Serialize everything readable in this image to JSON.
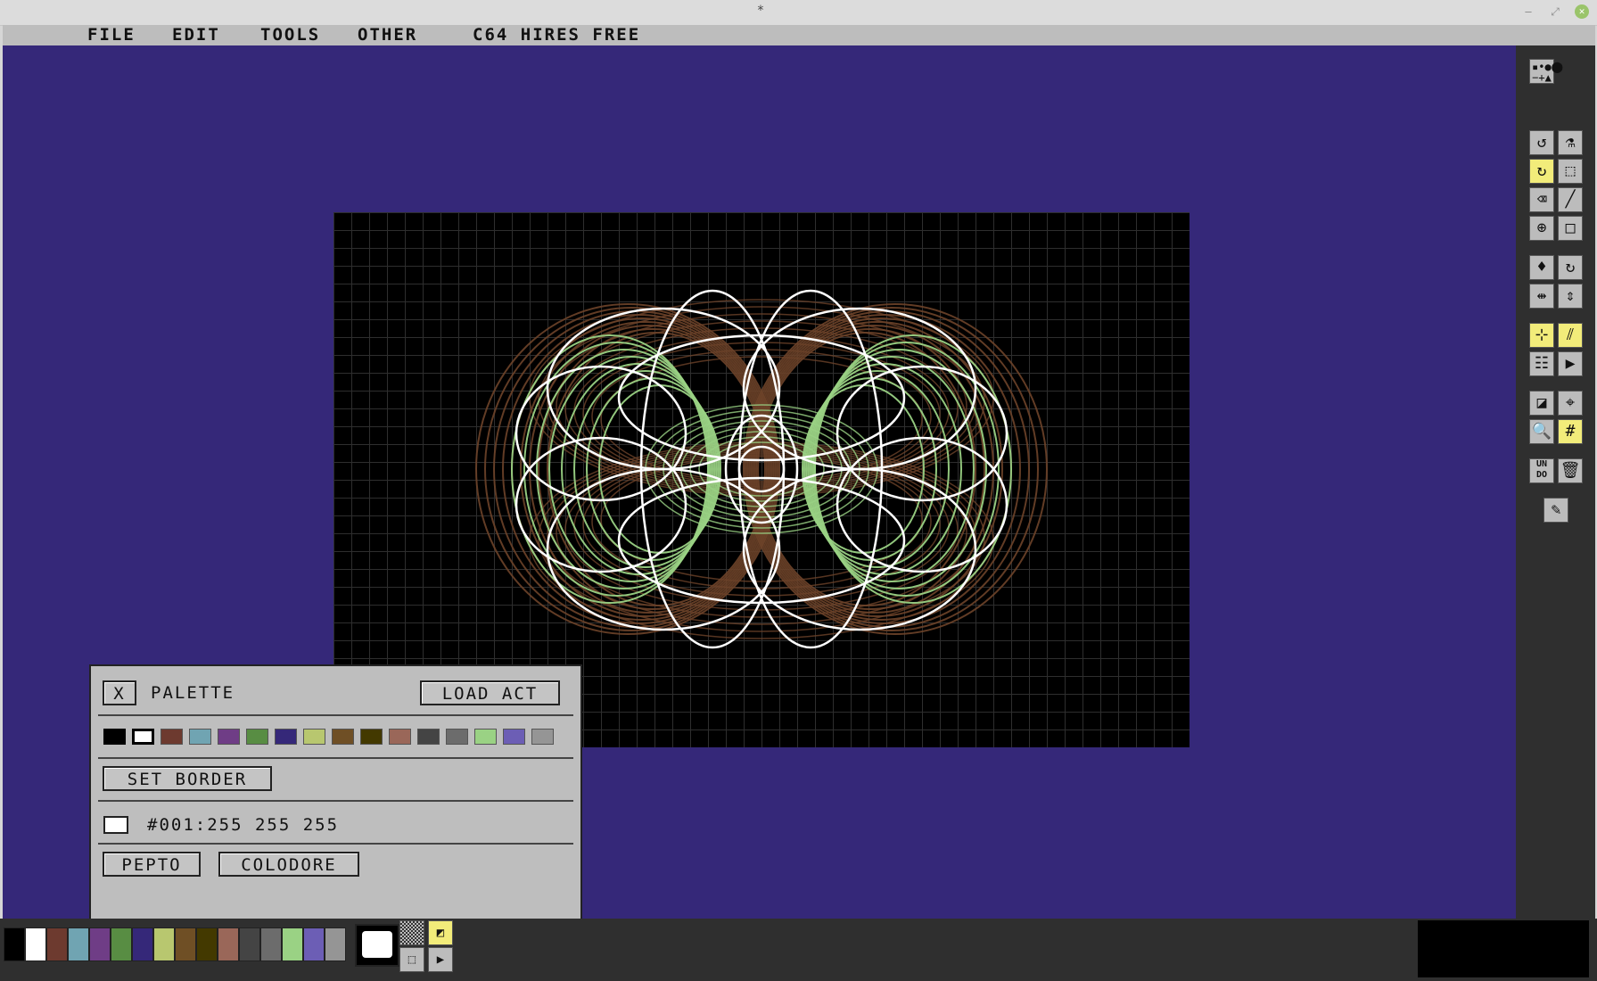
{
  "window": {
    "title": "*"
  },
  "menu": [
    "FILE",
    "EDIT",
    "TOOLS",
    "OTHER",
    "C64 HIRES FREE"
  ],
  "palette_panel": {
    "close_label": "X",
    "title": "PALETTE",
    "load_act_label": "LOAD ACT",
    "set_border_label": "SET BORDER",
    "color_readout": "#001:255 255 255",
    "pepto_label": "PEPTO",
    "colodore_label": "COLODORE"
  },
  "colors": {
    "workspace_bg": "#352879",
    "canvas_bg": "#000000",
    "white_curves": "#ffffff",
    "green_curves": "#9ad284",
    "brown_curves": "#6d4229",
    "highlight_tool": "#f2ec7a"
  },
  "c64_palette": [
    "#000000",
    "#ffffff",
    "#6d3a2f",
    "#70a4b2",
    "#6f3d86",
    "#588d43",
    "#352879",
    "#b8c76f",
    "#6f4f25",
    "#433900",
    "#9a6759",
    "#444444",
    "#6c6c6c",
    "#9ad284",
    "#6c5eb5",
    "#959595"
  ],
  "toolbar_icons": [
    "pen-dot-icon",
    "brush-dot-icon",
    "brush-small-icon",
    "brush-large-icon",
    "line-minus-icon",
    "line-plus-icon",
    "stamp-icon",
    "lasso-icon",
    "spray-icon",
    "rotate-icon",
    "selection-icon",
    "eraser-icon",
    "line-draw-icon",
    "circle-crosshair-icon",
    "rectangle-icon",
    "fill-bucket-icon",
    "repeat-icon",
    "flip-horizontal-icon",
    "flip-vertical-icon",
    "mirror-x-icon",
    "mirror-y-icon",
    "align-icon",
    "play-icon",
    "half-brush-icon",
    "crosshair-icon",
    "zoom-icon",
    "grid-icon",
    "undo-icon",
    "trash-icon",
    "eyedropper-icon"
  ]
}
